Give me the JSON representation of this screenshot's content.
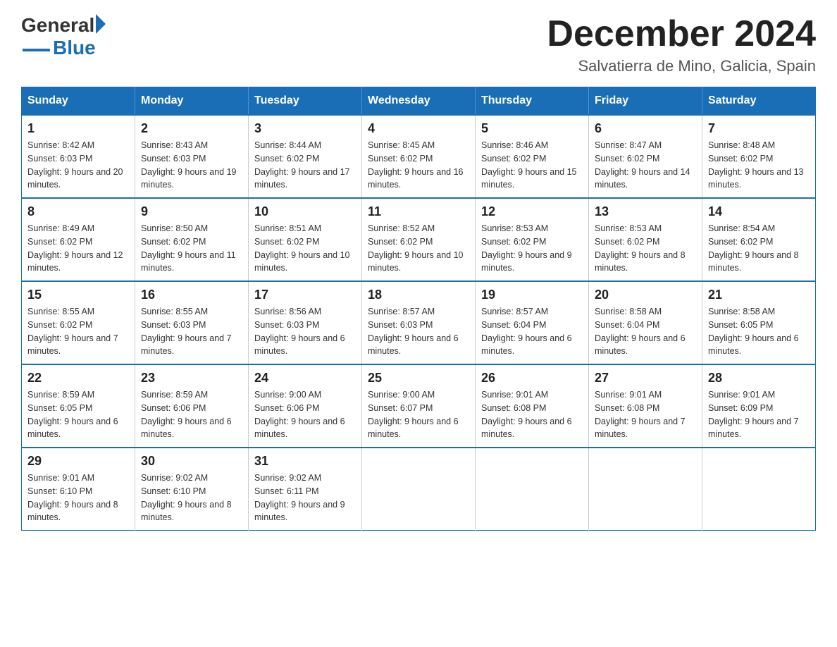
{
  "logo": {
    "general": "General",
    "blue": "Blue"
  },
  "title": "December 2024",
  "subtitle": "Salvatierra de Mino, Galicia, Spain",
  "days_header": [
    "Sunday",
    "Monday",
    "Tuesday",
    "Wednesday",
    "Thursday",
    "Friday",
    "Saturday"
  ],
  "weeks": [
    [
      {
        "day": "1",
        "sunrise": "8:42 AM",
        "sunset": "6:03 PM",
        "daylight": "9 hours and 20 minutes."
      },
      {
        "day": "2",
        "sunrise": "8:43 AM",
        "sunset": "6:03 PM",
        "daylight": "9 hours and 19 minutes."
      },
      {
        "day": "3",
        "sunrise": "8:44 AM",
        "sunset": "6:02 PM",
        "daylight": "9 hours and 17 minutes."
      },
      {
        "day": "4",
        "sunrise": "8:45 AM",
        "sunset": "6:02 PM",
        "daylight": "9 hours and 16 minutes."
      },
      {
        "day": "5",
        "sunrise": "8:46 AM",
        "sunset": "6:02 PM",
        "daylight": "9 hours and 15 minutes."
      },
      {
        "day": "6",
        "sunrise": "8:47 AM",
        "sunset": "6:02 PM",
        "daylight": "9 hours and 14 minutes."
      },
      {
        "day": "7",
        "sunrise": "8:48 AM",
        "sunset": "6:02 PM",
        "daylight": "9 hours and 13 minutes."
      }
    ],
    [
      {
        "day": "8",
        "sunrise": "8:49 AM",
        "sunset": "6:02 PM",
        "daylight": "9 hours and 12 minutes."
      },
      {
        "day": "9",
        "sunrise": "8:50 AM",
        "sunset": "6:02 PM",
        "daylight": "9 hours and 11 minutes."
      },
      {
        "day": "10",
        "sunrise": "8:51 AM",
        "sunset": "6:02 PM",
        "daylight": "9 hours and 10 minutes."
      },
      {
        "day": "11",
        "sunrise": "8:52 AM",
        "sunset": "6:02 PM",
        "daylight": "9 hours and 10 minutes."
      },
      {
        "day": "12",
        "sunrise": "8:53 AM",
        "sunset": "6:02 PM",
        "daylight": "9 hours and 9 minutes."
      },
      {
        "day": "13",
        "sunrise": "8:53 AM",
        "sunset": "6:02 PM",
        "daylight": "9 hours and 8 minutes."
      },
      {
        "day": "14",
        "sunrise": "8:54 AM",
        "sunset": "6:02 PM",
        "daylight": "9 hours and 8 minutes."
      }
    ],
    [
      {
        "day": "15",
        "sunrise": "8:55 AM",
        "sunset": "6:02 PM",
        "daylight": "9 hours and 7 minutes."
      },
      {
        "day": "16",
        "sunrise": "8:55 AM",
        "sunset": "6:03 PM",
        "daylight": "9 hours and 7 minutes."
      },
      {
        "day": "17",
        "sunrise": "8:56 AM",
        "sunset": "6:03 PM",
        "daylight": "9 hours and 6 minutes."
      },
      {
        "day": "18",
        "sunrise": "8:57 AM",
        "sunset": "6:03 PM",
        "daylight": "9 hours and 6 minutes."
      },
      {
        "day": "19",
        "sunrise": "8:57 AM",
        "sunset": "6:04 PM",
        "daylight": "9 hours and 6 minutes."
      },
      {
        "day": "20",
        "sunrise": "8:58 AM",
        "sunset": "6:04 PM",
        "daylight": "9 hours and 6 minutes."
      },
      {
        "day": "21",
        "sunrise": "8:58 AM",
        "sunset": "6:05 PM",
        "daylight": "9 hours and 6 minutes."
      }
    ],
    [
      {
        "day": "22",
        "sunrise": "8:59 AM",
        "sunset": "6:05 PM",
        "daylight": "9 hours and 6 minutes."
      },
      {
        "day": "23",
        "sunrise": "8:59 AM",
        "sunset": "6:06 PM",
        "daylight": "9 hours and 6 minutes."
      },
      {
        "day": "24",
        "sunrise": "9:00 AM",
        "sunset": "6:06 PM",
        "daylight": "9 hours and 6 minutes."
      },
      {
        "day": "25",
        "sunrise": "9:00 AM",
        "sunset": "6:07 PM",
        "daylight": "9 hours and 6 minutes."
      },
      {
        "day": "26",
        "sunrise": "9:01 AM",
        "sunset": "6:08 PM",
        "daylight": "9 hours and 6 minutes."
      },
      {
        "day": "27",
        "sunrise": "9:01 AM",
        "sunset": "6:08 PM",
        "daylight": "9 hours and 7 minutes."
      },
      {
        "day": "28",
        "sunrise": "9:01 AM",
        "sunset": "6:09 PM",
        "daylight": "9 hours and 7 minutes."
      }
    ],
    [
      {
        "day": "29",
        "sunrise": "9:01 AM",
        "sunset": "6:10 PM",
        "daylight": "9 hours and 8 minutes."
      },
      {
        "day": "30",
        "sunrise": "9:02 AM",
        "sunset": "6:10 PM",
        "daylight": "9 hours and 8 minutes."
      },
      {
        "day": "31",
        "sunrise": "9:02 AM",
        "sunset": "6:11 PM",
        "daylight": "9 hours and 9 minutes."
      },
      null,
      null,
      null,
      null
    ]
  ]
}
